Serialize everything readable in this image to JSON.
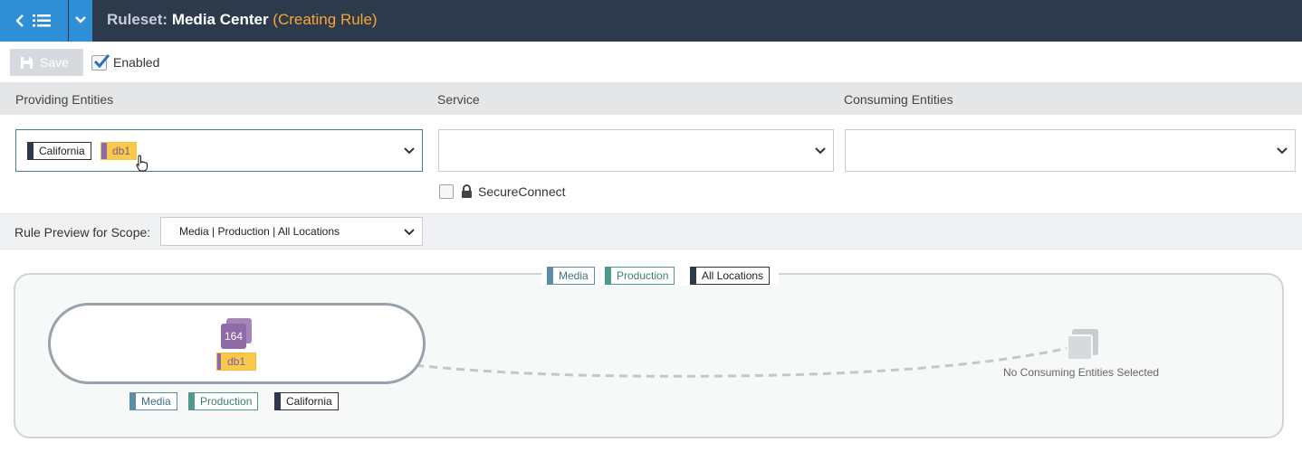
{
  "header": {
    "title_prefix": "Ruleset:",
    "title_name": "Media Center",
    "title_status": "(Creating Rule)",
    "nav_icon": "back-list-icon",
    "dropdown_icon": "chevron-down-icon"
  },
  "toolbar": {
    "save_label": "Save",
    "enabled_label": "Enabled",
    "enabled_checked": true
  },
  "columns": {
    "providing": "Providing Entities",
    "service": "Service",
    "consuming": "Consuming Entities"
  },
  "providing_select": {
    "tags": [
      {
        "text": "California",
        "kind": "location"
      },
      {
        "text": "db1",
        "kind": "label"
      }
    ]
  },
  "service_select": {
    "value": ""
  },
  "consuming_select": {
    "value": ""
  },
  "secure_connect": {
    "label": "SecureConnect",
    "checked": false
  },
  "preview": {
    "label": "Rule Preview for Scope:",
    "scope_value": "Media | Production | All Locations"
  },
  "diagram": {
    "scope_tags": [
      {
        "text": "Media",
        "kind": "app"
      },
      {
        "text": "Production",
        "kind": "env"
      },
      {
        "text": "All Locations",
        "kind": "location"
      }
    ],
    "provider_node": {
      "count": "164",
      "label": "db1"
    },
    "provider_tags": [
      {
        "text": "Media",
        "kind": "app"
      },
      {
        "text": "Production",
        "kind": "env"
      },
      {
        "text": "California",
        "kind": "location"
      }
    ],
    "consumer_placeholder": "No Consuming Entities Selected"
  },
  "colors": {
    "header_bg": "#2d3a4b",
    "nav_blue": "#2f8fd6",
    "status_orange": "#f7a634",
    "label_yellow": "#f8c94a",
    "workload_purple": "#8e6aa6",
    "app_bar": "#5b8ea6",
    "env_bar": "#4e9a8a",
    "loc_bar": "#2d3a4b"
  }
}
